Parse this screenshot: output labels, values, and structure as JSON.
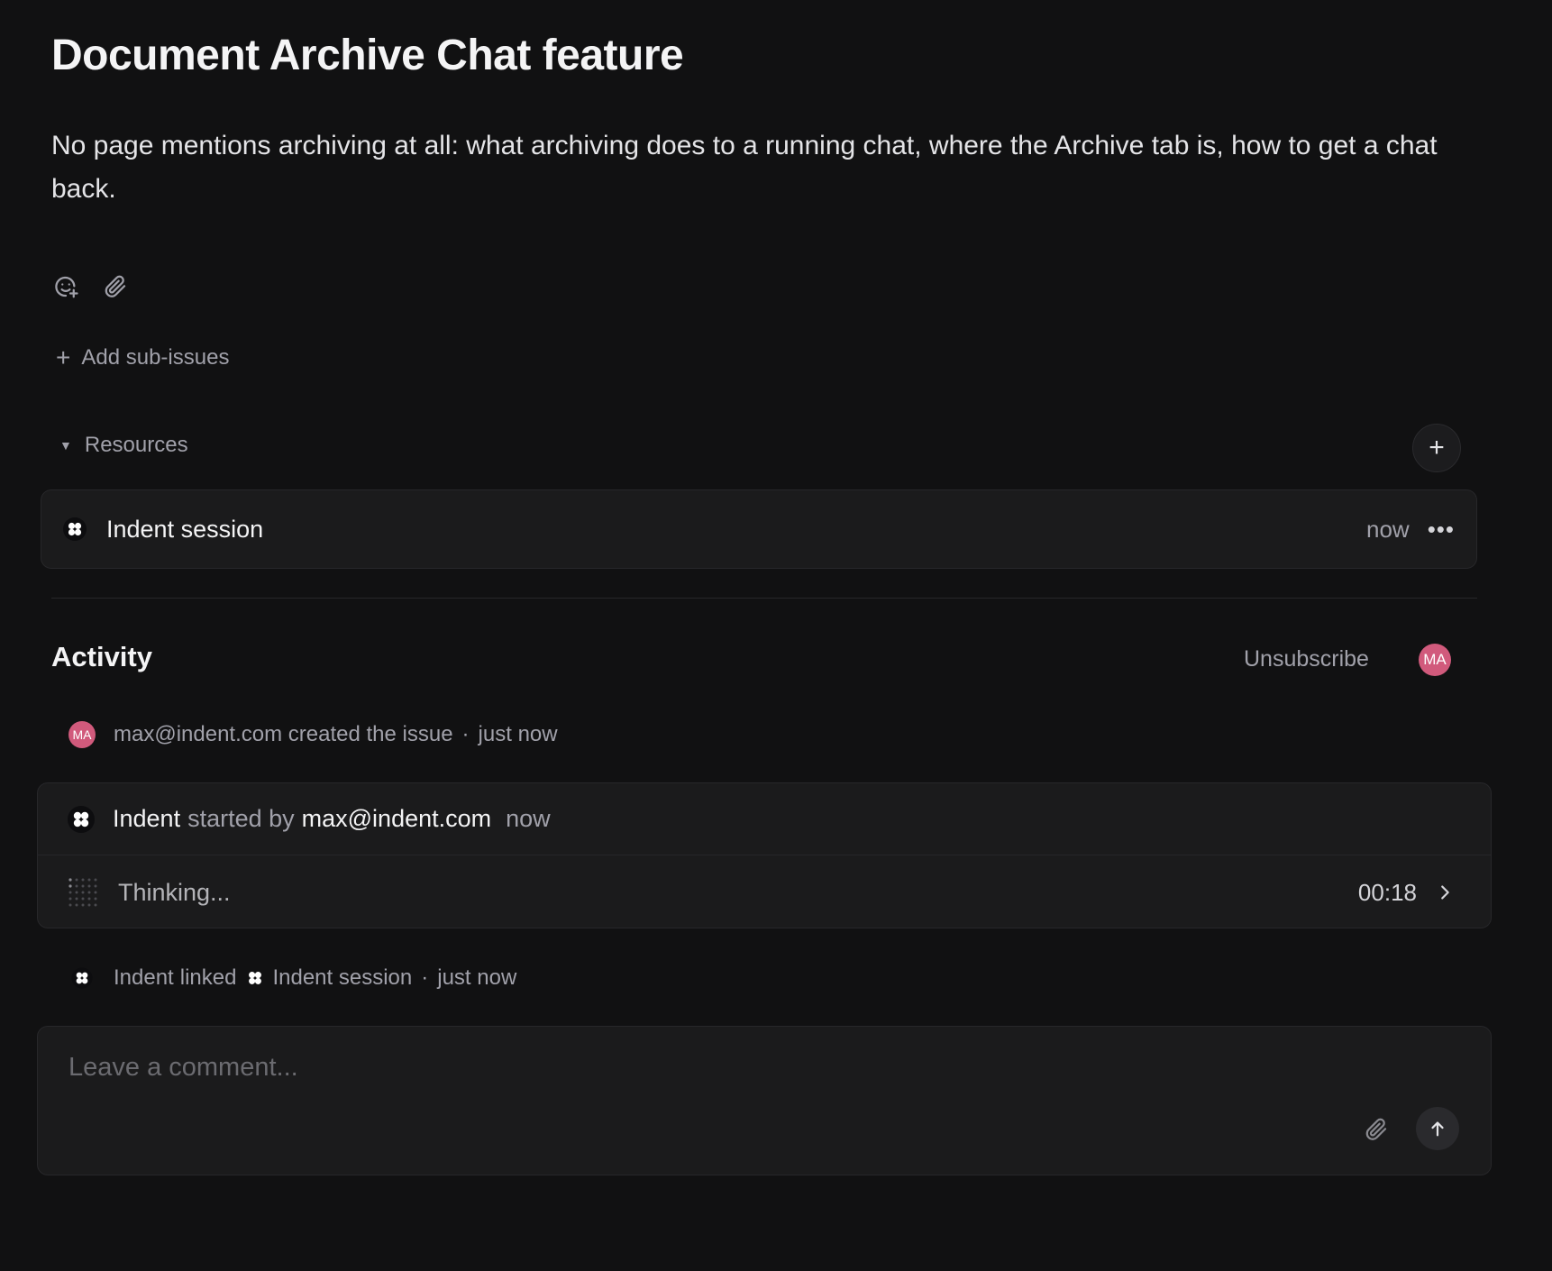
{
  "issue": {
    "title": "Document Archive Chat feature",
    "description": "No page mentions archiving at all: what archiving does to a running chat, where the Archive tab is, how to get a chat back."
  },
  "toolbar": {
    "icons": [
      "emoji-add-icon",
      "paperclip-icon"
    ]
  },
  "sub_issues": {
    "add_label": "Add sub-issues"
  },
  "resources": {
    "heading": "Resources",
    "items": [
      {
        "name": "Indent session",
        "time": "now"
      }
    ]
  },
  "activity": {
    "heading": "Activity",
    "unsubscribe_label": "Unsubscribe",
    "subscriber_initials": "MA",
    "created_event": {
      "avatar_initials": "MA",
      "text": "max@indent.com created the issue",
      "separator": "·",
      "time": "just now"
    },
    "session": {
      "app": "Indent",
      "started_by_label": "started by",
      "user": "max@indent.com",
      "time": "now",
      "status": "Thinking...",
      "elapsed": "00:18"
    },
    "linked_event": {
      "actor": "Indent",
      "action": "linked",
      "target": "Indent session",
      "separator": "·",
      "time": "just now"
    }
  },
  "comment": {
    "placeholder": "Leave a comment..."
  },
  "colors": {
    "background": "#111112",
    "card": "#1b1b1c",
    "avatar": "#d15a7c",
    "muted_text": "#a1a1aa"
  }
}
